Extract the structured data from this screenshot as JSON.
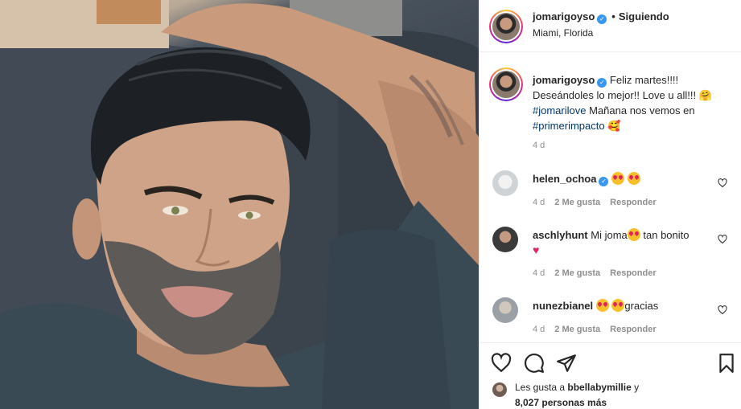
{
  "post": {
    "username": "jomarigoyso",
    "follow_status": "Siguiendo",
    "location": "Miami, Florida"
  },
  "caption": {
    "username": "jomarigoyso",
    "text_line1": "Feliz martes!!!!",
    "text_line2": "Deseándoles lo mejor!! Love u all!!!",
    "hashtag1": "#jomarilove",
    "text_line3": "Mañana nos vemos en",
    "hashtag2": "#primerimpacto",
    "time": "4 d"
  },
  "comments": [
    {
      "username": "helen_ochoa",
      "text": "",
      "time": "4 d",
      "likes": "2 Me gusta",
      "reply": "Responder"
    },
    {
      "username": "aschlyhunt",
      "text_before": "Mi joma",
      "text_after": "tan bonito",
      "time": "4 d",
      "likes": "2 Me gusta",
      "reply": "Responder"
    },
    {
      "username": "nunezbianel",
      "text": "gracias",
      "time": "4 d",
      "likes": "2 Me gusta",
      "reply": "Responder"
    }
  ],
  "likes_summary": {
    "prefix": "Les gusta a",
    "user": "bbellabymillie",
    "suffix": "y",
    "count": "8,027 personas más"
  },
  "icons": [
    "verified-icon",
    "heart-icon",
    "comment-icon",
    "share-icon",
    "bookmark-icon"
  ],
  "colors": {
    "link": "#00376b",
    "verified": "#3897f0",
    "muted": "#8e8e8e"
  }
}
